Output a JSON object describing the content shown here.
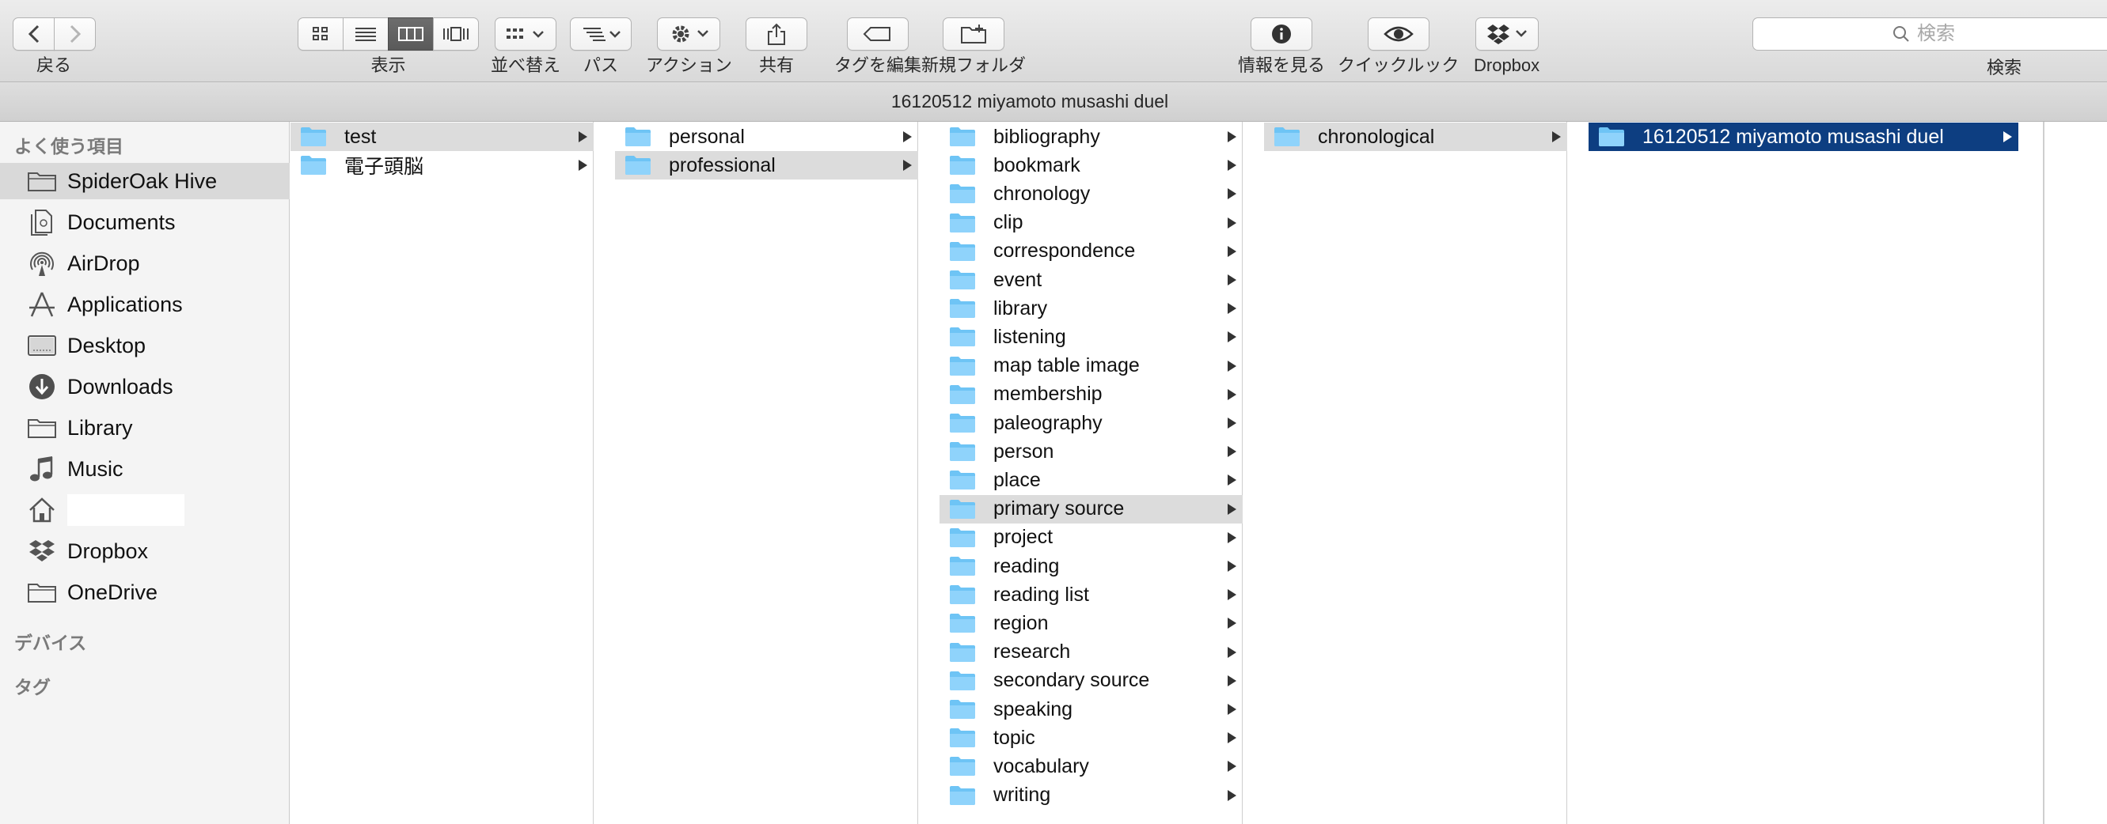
{
  "toolbar": {
    "back_label": "戻る",
    "view_label": "表示",
    "sort_label": "並べ替え",
    "path_label": "パス",
    "action_label": "アクション",
    "share_label": "共有",
    "edit_tags_label": "タグを編集",
    "new_folder_label": "新規フォルダ",
    "get_info_label": "情報を見る",
    "quicklook_label": "クイックルック",
    "dropbox_label": "Dropbox",
    "search_label": "検索",
    "search_placeholder": "検索",
    "active_view": "columns"
  },
  "pathbar": {
    "title": "16120512 miyamoto musashi duel"
  },
  "sidebar": {
    "favorites_header": "よく使う項目",
    "devices_header": "デバイス",
    "tags_header": "タグ",
    "items": [
      {
        "label": "SpiderOak Hive",
        "icon": "folder-icon",
        "selected": true
      },
      {
        "label": "Documents",
        "icon": "documents-icon"
      },
      {
        "label": "AirDrop",
        "icon": "airdrop-icon"
      },
      {
        "label": "Applications",
        "icon": "applications-icon"
      },
      {
        "label": "Desktop",
        "icon": "desktop-icon"
      },
      {
        "label": "Downloads",
        "icon": "downloads-icon"
      },
      {
        "label": "Library",
        "icon": "folder-icon"
      },
      {
        "label": "Music",
        "icon": "music-icon"
      },
      {
        "label": "",
        "icon": "home-icon"
      },
      {
        "label": "Dropbox",
        "icon": "dropbox-icon"
      },
      {
        "label": "OneDrive",
        "icon": "folder-icon"
      }
    ]
  },
  "columns": [
    {
      "items": [
        {
          "label": "test",
          "selected": "gray"
        },
        {
          "label": "電子頭脳"
        }
      ]
    },
    {
      "items": [
        {
          "label": "personal"
        },
        {
          "label": "professional",
          "selected": "gray"
        }
      ]
    },
    {
      "items": [
        {
          "label": "bibliography"
        },
        {
          "label": "bookmark"
        },
        {
          "label": "chronology"
        },
        {
          "label": "clip"
        },
        {
          "label": "correspondence"
        },
        {
          "label": "event"
        },
        {
          "label": "library"
        },
        {
          "label": "listening"
        },
        {
          "label": "map table image"
        },
        {
          "label": "membership"
        },
        {
          "label": "paleography"
        },
        {
          "label": "person"
        },
        {
          "label": "place"
        },
        {
          "label": "primary source",
          "selected": "gray"
        },
        {
          "label": "project"
        },
        {
          "label": "reading"
        },
        {
          "label": "reading list"
        },
        {
          "label": "region"
        },
        {
          "label": "research"
        },
        {
          "label": "secondary source"
        },
        {
          "label": "speaking"
        },
        {
          "label": "topic"
        },
        {
          "label": "vocabulary"
        },
        {
          "label": "writing"
        }
      ]
    },
    {
      "items": [
        {
          "label": "chronological",
          "selected": "gray"
        }
      ]
    },
    {
      "items": [
        {
          "label": "16120512 miyamoto musashi duel",
          "selected": "blue"
        }
      ]
    }
  ],
  "colors": {
    "selection_blue": "#0d3e81",
    "selection_gray": "#dcdcdc",
    "folder_blue": "#6ec4f5",
    "sidebar_bg": "#f4f4f4"
  }
}
